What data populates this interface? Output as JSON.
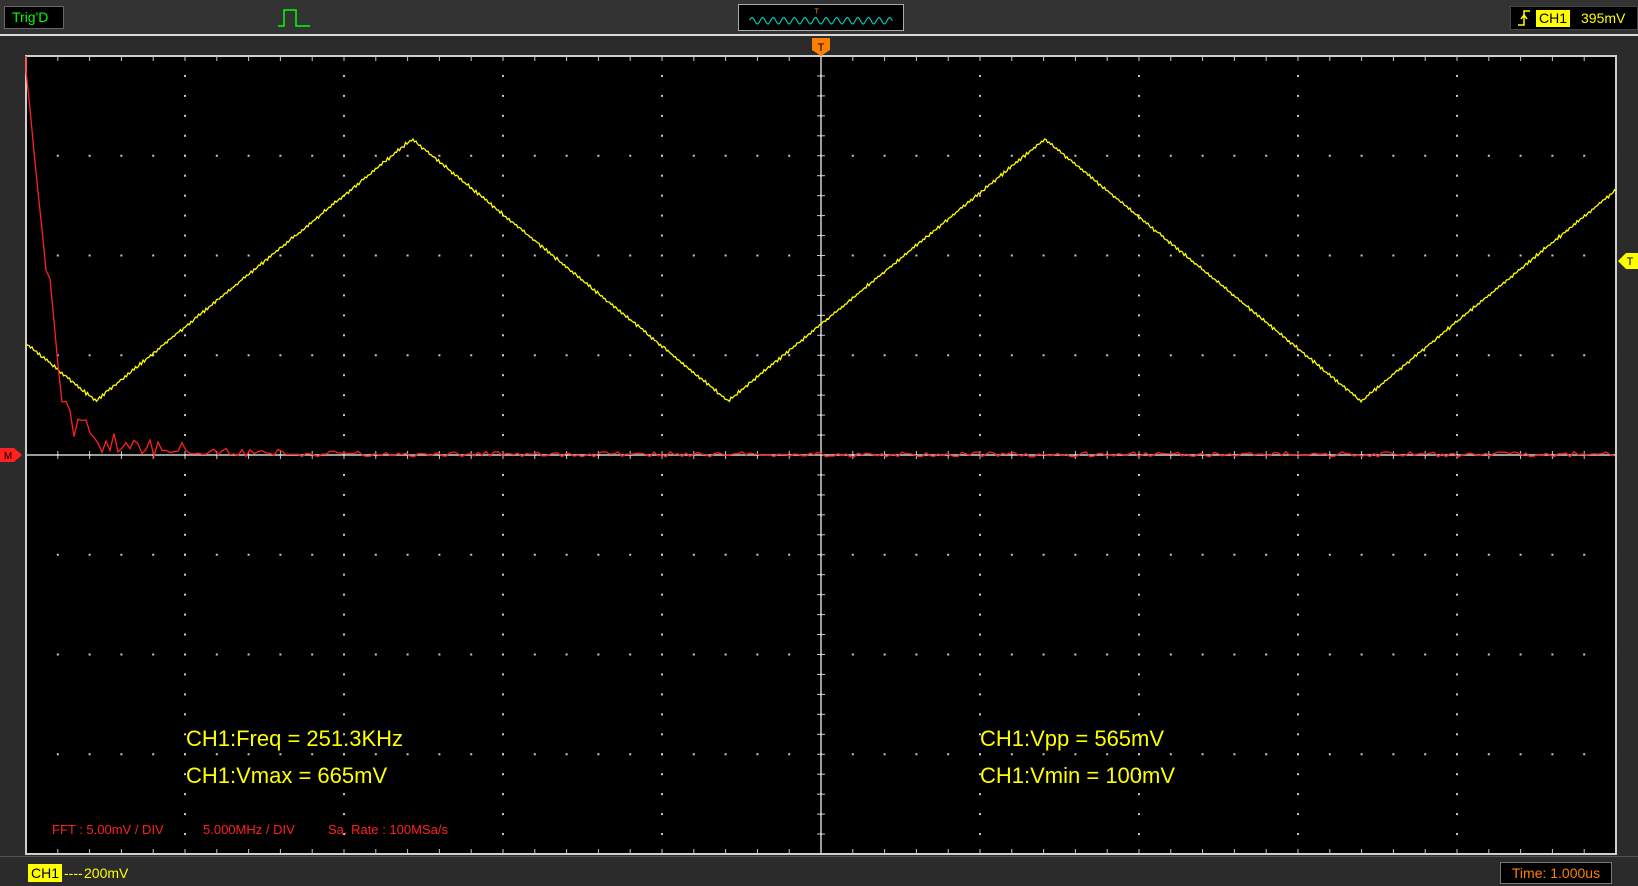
{
  "header": {
    "trigger_status": "Trig'D",
    "trigger_channel": "CH1",
    "trigger_level": "395mV",
    "trigger_marker_label": "T"
  },
  "screen": {
    "grid_divisions": {
      "horizontal": 10,
      "vertical": 8
    },
    "colors": {
      "ch1": "#ffff00",
      "fft": "#ff2020",
      "grid": "#c8c8c8",
      "background": "#000000",
      "trigger_marker": "#ff8000"
    },
    "markers": {
      "trigger_top": "T",
      "trigger_right": "T",
      "math_left": "M"
    }
  },
  "measurements": {
    "freq": "CH1:Freq = 251.3KHz",
    "vmax": "CH1:Vmax = 665mV",
    "vpp": "CH1:Vpp = 565mV",
    "vmin": "CH1:Vmin = 100mV"
  },
  "fft": {
    "vdiv": "FFT :  5.00mV / DIV",
    "hdiv": "5.000MHz / DIV",
    "rate": "Sa. Rate : 100MSa/s"
  },
  "footer": {
    "channel": "CH1",
    "coupling": "----",
    "vdiv": "200mV",
    "timebase": "Time: 1.000us"
  },
  "chart_data": {
    "type": "line",
    "series": [
      {
        "name": "CH1",
        "shape": "triangle",
        "frequency_khz": 251.3,
        "vmax_mv": 665,
        "vmin_mv": 100,
        "vpp_mv": 565
      },
      {
        "name": "FFT",
        "shape": "spectrum"
      }
    ],
    "xlabel": "",
    "ylabel": ""
  }
}
